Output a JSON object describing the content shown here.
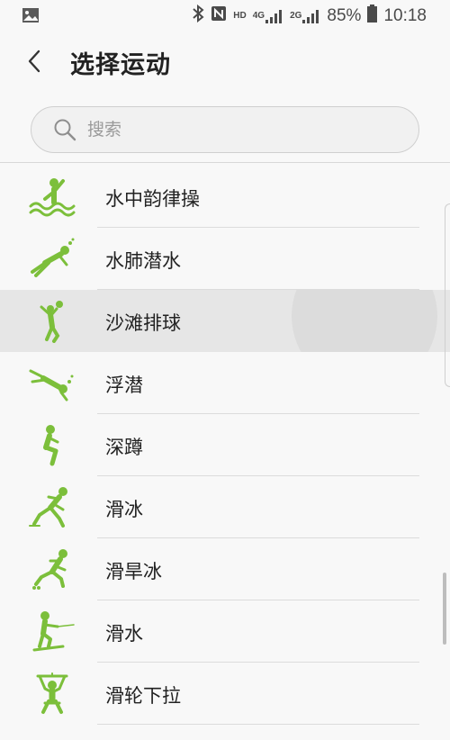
{
  "status_bar": {
    "left_icon": "image-icon",
    "icons": [
      "bluetooth-icon",
      "nfc-icon"
    ],
    "hd": "HD",
    "net_4g": "4G",
    "net_2g": "2G",
    "battery_percent": "85%",
    "time": "10:18"
  },
  "header": {
    "back_icon": "back-arrow-icon",
    "title": "选择运动"
  },
  "search": {
    "placeholder": "搜索",
    "value": ""
  },
  "list": {
    "items": [
      {
        "label": "水中韵律操",
        "icon": "water-aerobics-icon"
      },
      {
        "label": "水肺潜水",
        "icon": "scuba-diving-icon"
      },
      {
        "label": "沙滩排球",
        "icon": "beach-volleyball-icon",
        "highlighted": true
      },
      {
        "label": "浮潜",
        "icon": "snorkeling-icon"
      },
      {
        "label": "深蹲",
        "icon": "squat-icon"
      },
      {
        "label": "滑冰",
        "icon": "skating-icon"
      },
      {
        "label": "滑旱冰",
        "icon": "roller-skating-icon"
      },
      {
        "label": "滑水",
        "icon": "water-skiing-icon"
      },
      {
        "label": "滑轮下拉",
        "icon": "lat-pulldown-icon"
      }
    ]
  },
  "colors": {
    "icon_green": "#7cbf3b",
    "text": "#222222",
    "background": "#f8f8f8"
  }
}
